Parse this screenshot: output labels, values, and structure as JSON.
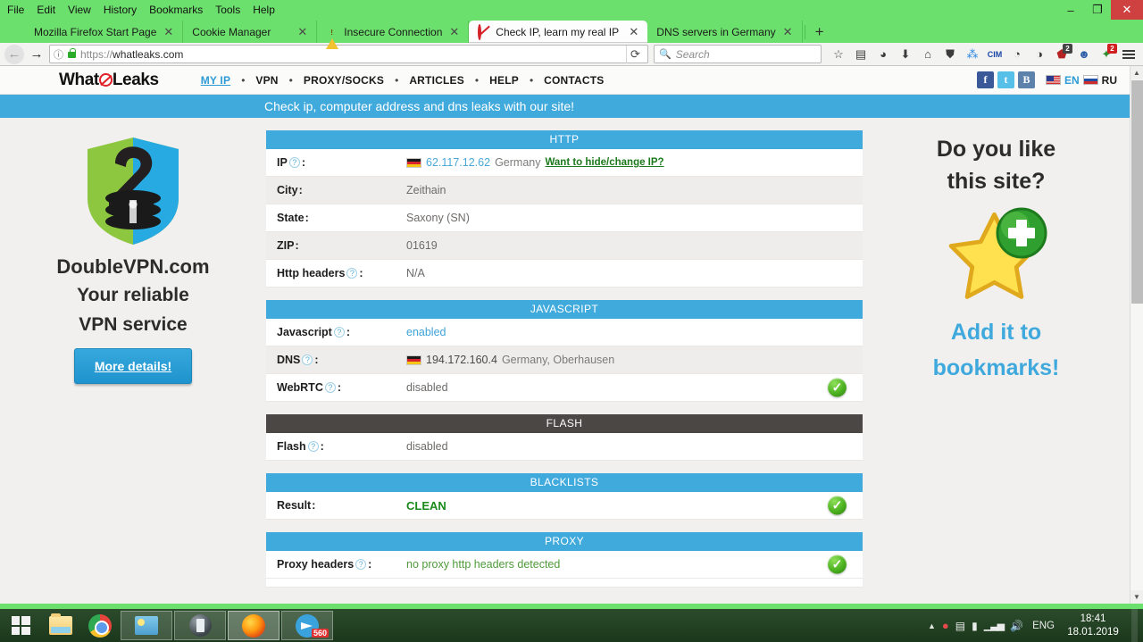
{
  "browser": {
    "menu": [
      "File",
      "Edit",
      "View",
      "History",
      "Bookmarks",
      "Tools",
      "Help"
    ],
    "window_controls": {
      "minimize": "–",
      "restore": "❐",
      "close": "✕"
    },
    "tabs": [
      {
        "title": "Mozilla Firefox Start Page",
        "favicon": "firefox-icon",
        "active": false,
        "close": "✕"
      },
      {
        "title": "Cookie Manager",
        "favicon": "none",
        "active": false,
        "close": "✕"
      },
      {
        "title": "Insecure Connection",
        "favicon": "warning-icon",
        "active": false,
        "close": "✕"
      },
      {
        "title": "Check IP, learn my real IP co",
        "favicon": "whatleaks-icon",
        "active": true,
        "close": "✕"
      },
      {
        "title": "DNS servers in Germany",
        "favicon": "none",
        "active": false,
        "close": "✕"
      }
    ],
    "new_tab_label": "+",
    "nav": {
      "back": "←",
      "forward": "→",
      "reload": "⟳",
      "info": "ⓘ"
    },
    "url": {
      "scheme": "https://",
      "host": "whatleaks.com"
    },
    "search": {
      "placeholder": "Search",
      "icon": "search-icon"
    },
    "toolbar_icons": [
      {
        "name": "bookmark-star-icon",
        "glyph": "☆",
        "badge": ""
      },
      {
        "name": "reader-list-icon",
        "glyph": "▤",
        "badge": ""
      },
      {
        "name": "account-icon",
        "glyph": "◕",
        "badge": ""
      },
      {
        "name": "downloads-icon",
        "glyph": "⬇",
        "badge": ""
      },
      {
        "name": "home-icon",
        "glyph": "⌂",
        "badge": ""
      },
      {
        "name": "shield-icon",
        "glyph": "⛊",
        "badge": ""
      },
      {
        "name": "share-icon",
        "glyph": "⁂",
        "badge": ""
      },
      {
        "name": "cim-extension-icon",
        "glyph": "CIM",
        "badge": ""
      },
      {
        "name": "ghostery-icon",
        "glyph": "◔",
        "badge": ""
      },
      {
        "name": "privacy-badger-icon",
        "glyph": "◑",
        "badge": ""
      },
      {
        "name": "ublock-origin-icon",
        "glyph": "⬟",
        "badge": "2"
      },
      {
        "name": "webcam-guard-icon",
        "glyph": "☻",
        "badge": ""
      },
      {
        "name": "adblock-icon",
        "glyph": "✦",
        "badge": "2"
      }
    ],
    "menu_button": "hamburger-menu-icon"
  },
  "site": {
    "logo_left": "What",
    "logo_right": "Leaks",
    "nav": [
      {
        "label": "MY IP",
        "active": true
      },
      {
        "label": "VPN",
        "active": false
      },
      {
        "label": "PROXY/SOCKS",
        "active": false
      },
      {
        "label": "ARTICLES",
        "active": false
      },
      {
        "label": "HELP",
        "active": false
      },
      {
        "label": "CONTACTS",
        "active": false
      }
    ],
    "nav_separator": "•",
    "social": [
      {
        "name": "facebook-icon",
        "label": "f"
      },
      {
        "name": "twitter-icon",
        "label": "t"
      },
      {
        "name": "vk-icon",
        "label": "B"
      }
    ],
    "languages": [
      {
        "code": "EN",
        "flag": "us-flag-icon",
        "active": true
      },
      {
        "code": "RU",
        "flag": "ru-flag-icon",
        "active": false
      }
    ],
    "banner": "Check ip, computer address and dns leaks with our site!",
    "accent_color": "#41aadd",
    "dark_header_color": "#4a4745",
    "link_color": "#3ea3d8"
  },
  "ad_left": {
    "logo": "doublevpn-shield-logo",
    "title": "DoubleVPN.com",
    "line1": "Your reliable",
    "line2": "VPN service",
    "button": "More details!"
  },
  "promo_right": {
    "line1": "Do you like",
    "line2": "this site?",
    "icon": "star-plus-icon",
    "link1": "Add it to",
    "link2": "bookmarks!"
  },
  "sections": [
    {
      "title": "HTTP",
      "style": "blue",
      "rows": [
        {
          "label": "IP",
          "help": "?",
          "flag": "de-flag-icon",
          "ip": "62.117.12.62",
          "country": "Germany",
          "link": "Want to hide/change IP?",
          "check": false,
          "alt": false
        },
        {
          "label": "City",
          "help": "",
          "value": "Zeithain",
          "check": false,
          "alt": true
        },
        {
          "label": "State",
          "help": "",
          "value": "Saxony (SN)",
          "check": false,
          "alt": false
        },
        {
          "label": "ZIP",
          "help": "",
          "value": "01619",
          "check": false,
          "alt": true
        },
        {
          "label": "Http headers",
          "help": "?",
          "value": "N/A",
          "check": false,
          "alt": false
        }
      ]
    },
    {
      "title": "JAVASCRIPT",
      "style": "blue",
      "rows": [
        {
          "label": "Javascript",
          "help": "?",
          "value": "enabled",
          "value_style": "link",
          "check": false,
          "alt": false
        },
        {
          "label": "DNS",
          "help": "?",
          "flag": "de-flag-icon",
          "ip": "194.172.160.4",
          "country": "Germany, Oberhausen",
          "check": false,
          "alt": true
        },
        {
          "label": "WebRTC",
          "help": "?",
          "value": "disabled",
          "check": true,
          "alt": false
        }
      ]
    },
    {
      "title": "FLASH",
      "style": "dark",
      "rows": [
        {
          "label": "Flash",
          "help": "?",
          "value": "disabled",
          "check": false,
          "alt": false
        }
      ]
    },
    {
      "title": "BLACKLISTS",
      "style": "blue",
      "rows": [
        {
          "label": "Result",
          "help": "",
          "value": "CLEAN",
          "value_style": "clean",
          "check": true,
          "alt": false
        }
      ]
    },
    {
      "title": "PROXY",
      "style": "blue",
      "rows": [
        {
          "label": "Proxy headers",
          "help": "?",
          "value": "no proxy http headers detected",
          "value_style": "green",
          "check": true,
          "alt": false
        }
      ]
    }
  ],
  "taskbar": {
    "start": "windows-start-icon",
    "buttons": [
      {
        "name": "file-explorer-icon",
        "state": "pinned"
      },
      {
        "name": "chrome-icon",
        "state": "pinned"
      },
      {
        "name": "widget-app-icon",
        "state": "open"
      },
      {
        "name": "dark-app-icon",
        "state": "open"
      },
      {
        "name": "firefox-icon",
        "state": "active"
      },
      {
        "name": "telegram-icon",
        "state": "open",
        "badge": "560"
      }
    ],
    "tray": [
      {
        "name": "show-hidden-icons",
        "glyph": "▲"
      },
      {
        "name": "antivirus-tray-icon",
        "glyph": "●"
      },
      {
        "name": "network-error-icon",
        "glyph": "▤"
      },
      {
        "name": "usb-device-icon",
        "glyph": "▮"
      },
      {
        "name": "signal-icon",
        "glyph": "▁▃▅"
      },
      {
        "name": "volume-icon",
        "glyph": "🔊"
      }
    ],
    "language": "ENG",
    "time": "18:41",
    "date": "18.01.2019"
  }
}
